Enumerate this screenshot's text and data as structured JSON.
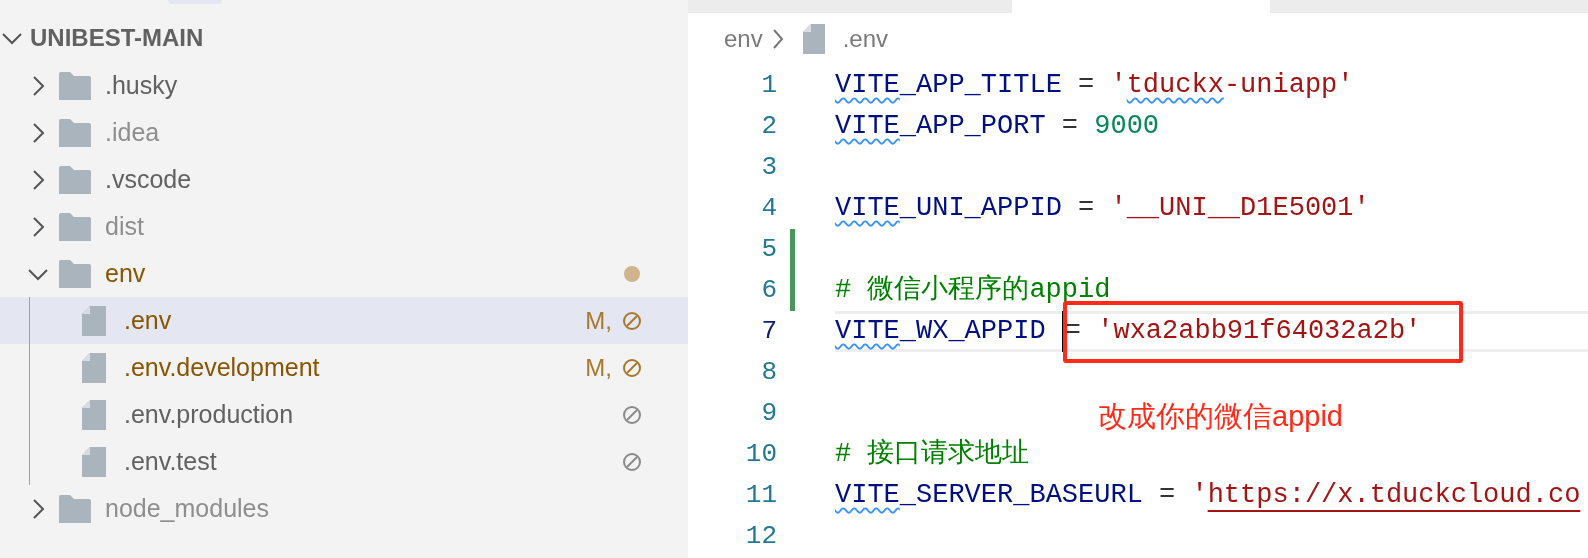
{
  "explorer": {
    "root": {
      "label": "UNIBEST-MAIN",
      "expanded": true
    },
    "items": [
      {
        "kind": "folder",
        "label": ".husky",
        "expanded": false,
        "ignored": false,
        "modified": false,
        "excluded": false,
        "selected": false
      },
      {
        "kind": "folder",
        "label": ".idea",
        "expanded": false,
        "ignored": true,
        "modified": false,
        "excluded": false,
        "selected": false
      },
      {
        "kind": "folder",
        "label": ".vscode",
        "expanded": false,
        "ignored": false,
        "modified": false,
        "excluded": false,
        "selected": false
      },
      {
        "kind": "folder",
        "label": "dist",
        "expanded": false,
        "ignored": true,
        "modified": false,
        "excluded": false,
        "selected": false
      },
      {
        "kind": "folder",
        "label": "env",
        "expanded": true,
        "ignored": false,
        "modified": true,
        "excluded": false,
        "selected": false,
        "children": [
          {
            "kind": "file",
            "label": ".env",
            "ignored": false,
            "modified": true,
            "badge": "M,",
            "excluded": true,
            "selected": true
          },
          {
            "kind": "file",
            "label": ".env.development",
            "ignored": false,
            "modified": true,
            "badge": "M,",
            "excluded": true,
            "selected": false
          },
          {
            "kind": "file",
            "label": ".env.production",
            "ignored": false,
            "modified": false,
            "excluded": true,
            "selected": false
          },
          {
            "kind": "file",
            "label": ".env.test",
            "ignored": false,
            "modified": false,
            "excluded": true,
            "selected": false
          }
        ]
      },
      {
        "kind": "folder",
        "label": "node_modules",
        "expanded": false,
        "ignored": true,
        "modified": false,
        "excluded": false,
        "selected": false
      }
    ]
  },
  "editor": {
    "tabs": [
      {
        "selected": false
      },
      {
        "selected": true
      },
      {
        "selected": false
      }
    ],
    "breadcrumb": [
      "env",
      ".env"
    ],
    "lines": [
      {
        "number": "1",
        "current": false,
        "changed": false,
        "tokens": [
          {
            "text": "VITE",
            "kind": "key_flagged"
          },
          {
            "text": "_APP_TITLE",
            "kind": "key"
          },
          {
            "text": " = ",
            "kind": "op"
          },
          {
            "text": "'",
            "kind": "string"
          },
          {
            "text": "tduckx",
            "kind": "string_flagged"
          },
          {
            "text": "-uniapp'",
            "kind": "string"
          }
        ]
      },
      {
        "number": "2",
        "current": false,
        "changed": false,
        "tokens": [
          {
            "text": "VITE",
            "kind": "key_flagged"
          },
          {
            "text": "_APP_PORT",
            "kind": "key"
          },
          {
            "text": " = ",
            "kind": "op"
          },
          {
            "text": "9000",
            "kind": "number"
          }
        ]
      },
      {
        "number": "3",
        "current": false,
        "changed": false
      },
      {
        "number": "4",
        "current": false,
        "changed": false,
        "tokens": [
          {
            "text": "VITE",
            "kind": "key_flagged"
          },
          {
            "text": "_UNI_APPID",
            "kind": "key"
          },
          {
            "text": " = ",
            "kind": "op"
          },
          {
            "text": "'__UNI__D1E5001'",
            "kind": "string"
          }
        ]
      },
      {
        "number": "5",
        "current": false,
        "changed": true
      },
      {
        "number": "6",
        "current": false,
        "changed": true,
        "tokens": [
          {
            "text": "# 微信小程序的appid",
            "kind": "comment"
          }
        ]
      },
      {
        "number": "7",
        "current": true,
        "changed": false,
        "tokens": [
          {
            "text": "VITE",
            "kind": "key_flagged"
          },
          {
            "text": "_WX_APPID ",
            "kind": "key"
          },
          {
            "text": "= ",
            "kind": "op_caret"
          },
          {
            "text": "'wxa2abb91f64032a2b'",
            "kind": "string"
          }
        ]
      },
      {
        "number": "8",
        "current": false,
        "changed": false
      },
      {
        "number": "9",
        "current": false,
        "changed": false
      },
      {
        "number": "10",
        "current": false,
        "changed": false,
        "tokens": [
          {
            "text": "# 接口请求地址",
            "kind": "comment"
          }
        ]
      },
      {
        "number": "11",
        "current": false,
        "changed": false,
        "tokens": [
          {
            "text": "VITE",
            "kind": "key_flagged"
          },
          {
            "text": "_SERVER_BASEURL",
            "kind": "key"
          },
          {
            "text": " = ",
            "kind": "op"
          },
          {
            "text": "'",
            "kind": "string"
          },
          {
            "text": "https://x.tduckcloud.co",
            "kind": "link"
          }
        ]
      },
      {
        "number": "12",
        "current": false,
        "changed": false
      }
    ]
  },
  "annotation": {
    "text": "改成你的微信appid"
  }
}
